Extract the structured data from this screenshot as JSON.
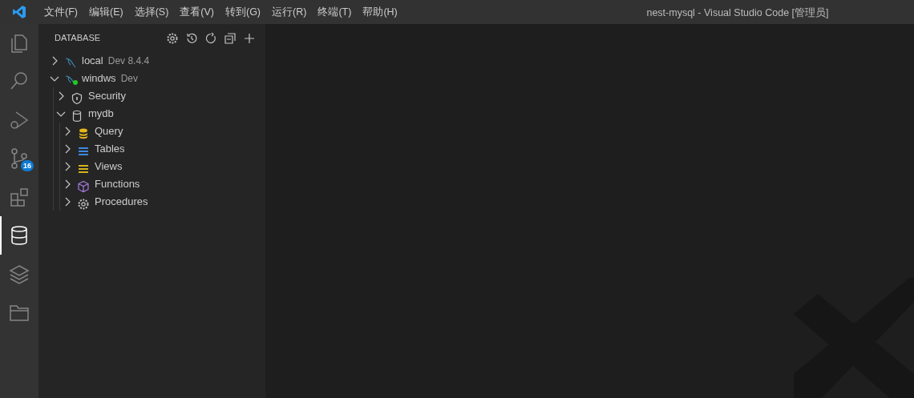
{
  "title_bar": {
    "menu": [
      "文件(F)",
      "编辑(E)",
      "选择(S)",
      "查看(V)",
      "转到(G)",
      "运行(R)",
      "终端(T)",
      "帮助(H)"
    ],
    "title": "nest-mysql - Visual Studio Code [管理员]"
  },
  "activity_bar": [
    {
      "kind": "explorer",
      "selected": false
    },
    {
      "kind": "search",
      "selected": false
    },
    {
      "kind": "debug",
      "selected": false
    },
    {
      "kind": "scm",
      "selected": false,
      "badge": "16"
    },
    {
      "kind": "extensions",
      "selected": false
    },
    {
      "kind": "database",
      "selected": true
    },
    {
      "kind": "layers",
      "selected": false
    },
    {
      "kind": "folder",
      "selected": false
    }
  ],
  "sidebar": {
    "title": "DATABASE",
    "tree": [
      {
        "kind": "mysql",
        "label": "local",
        "description": "Dev 8.4.4",
        "expanded": false,
        "connected": false
      },
      {
        "kind": "mysql",
        "label": "windws",
        "description": "Dev",
        "expanded": true,
        "connected": true,
        "children": [
          {
            "kind": "security",
            "label": "Security",
            "expanded": false
          },
          {
            "kind": "database",
            "label": "mydb",
            "expanded": true,
            "children": [
              {
                "kind": "query",
                "label": "Query",
                "expanded": false
              },
              {
                "kind": "tables",
                "label": "Tables",
                "expanded": false
              },
              {
                "kind": "views",
                "label": "Views",
                "expanded": false
              },
              {
                "kind": "functions",
                "label": "Functions",
                "expanded": false
              },
              {
                "kind": "procedures",
                "label": "Procedures",
                "expanded": false
              }
            ]
          }
        ]
      }
    ]
  }
}
